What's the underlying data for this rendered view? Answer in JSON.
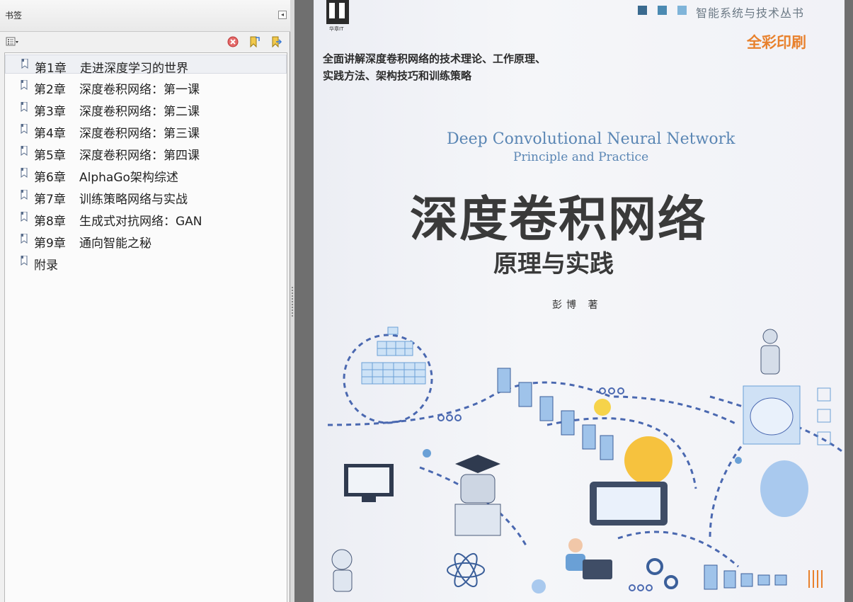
{
  "panel": {
    "title": "书签",
    "collapse_glyph": "◂",
    "toolbar": {
      "options_icon": "options-menu-icon",
      "delete_icon": "delete-bookmark-icon",
      "new_icon": "new-bookmark-icon",
      "expand_icon": "expand-bookmark-icon"
    },
    "bookmarks": [
      {
        "num": "第1章",
        "title": "走进深度学习的世界"
      },
      {
        "num": "第2章",
        "title": "深度卷积网络：第一课"
      },
      {
        "num": "第3章",
        "title": "深度卷积网络：第二课"
      },
      {
        "num": "第4章",
        "title": "深度卷积网络：第三课"
      },
      {
        "num": "第5章",
        "title": "深度卷积网络：第四课"
      },
      {
        "num": "第6章",
        "title": "AlphaGo架构综述"
      },
      {
        "num": "第7章",
        "title": "训练策略网络与实战"
      },
      {
        "num": "第8章",
        "title": "生成式对抗网络：GAN"
      },
      {
        "num": "第9章",
        "title": "通向智能之秘"
      },
      {
        "num": "附录",
        "title": ""
      }
    ]
  },
  "cover": {
    "logo_text": "华章IT",
    "series": "智能系统与技术丛书",
    "full_color": "全彩印刷",
    "tagline_1": "全面讲解深度卷积网络的技术理论、工作原理、",
    "tagline_2": "实践方法、架构技巧和训练策略",
    "title_en": "Deep Convolutional Neural Network",
    "subtitle_en": "Principle and Practice",
    "title_cn": "深度卷积网络",
    "subtitle_cn": "原理与实践",
    "author": "彭博 著"
  },
  "colors": {
    "accent_blue": "#5a86b4",
    "accent_orange": "#e8812d",
    "panel_bg": "#f0f0f0"
  }
}
